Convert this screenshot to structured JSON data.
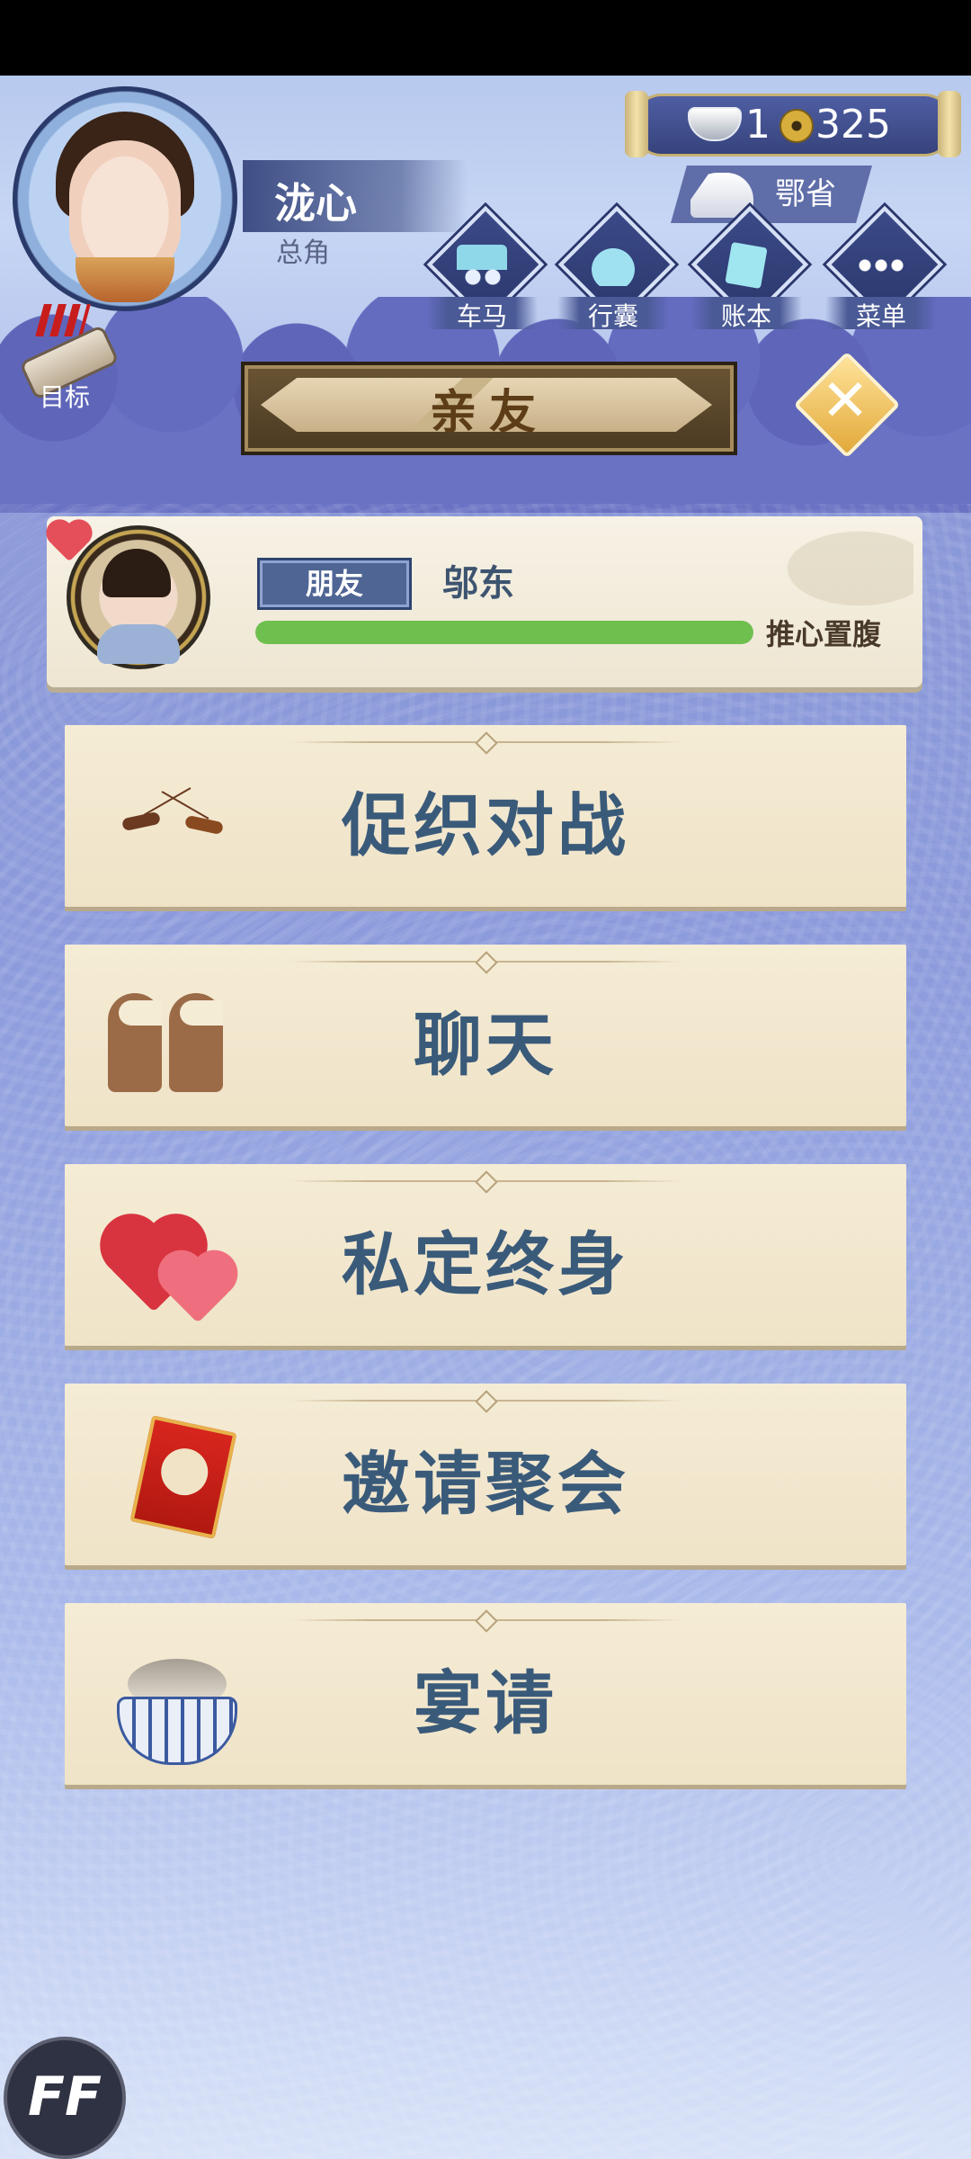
{
  "character": {
    "name": "泷心",
    "role": "总角"
  },
  "target": {
    "label": "目标"
  },
  "currency": {
    "silver": "1",
    "coins": "325"
  },
  "location": {
    "label": "鄂省"
  },
  "menu": [
    {
      "label": "车马",
      "icon": "carriage-icon"
    },
    {
      "label": "行囊",
      "icon": "bag-icon"
    },
    {
      "label": "账本",
      "icon": "ledger-icon"
    },
    {
      "label": "菜单",
      "icon": "more-icon"
    }
  ],
  "title": "亲友",
  "friend": {
    "relation": "朋友",
    "name": "邬东",
    "bond_level": "推心置腹",
    "bond_progress": 1.0
  },
  "actions": [
    {
      "label": "促织对战",
      "icon": "cricket-icon"
    },
    {
      "label": "聊天",
      "icon": "chat-icon"
    },
    {
      "label": "私定终身",
      "icon": "hearts-icon"
    },
    {
      "label": "邀请聚会",
      "icon": "invitation-icon"
    },
    {
      "label": "宴请",
      "icon": "banquet-icon"
    }
  ],
  "overlay_badge": "FF",
  "colors": {
    "accent": "#3a5a7a",
    "bond_bar": "#6fbf4f",
    "background": "#8c9bdc"
  }
}
